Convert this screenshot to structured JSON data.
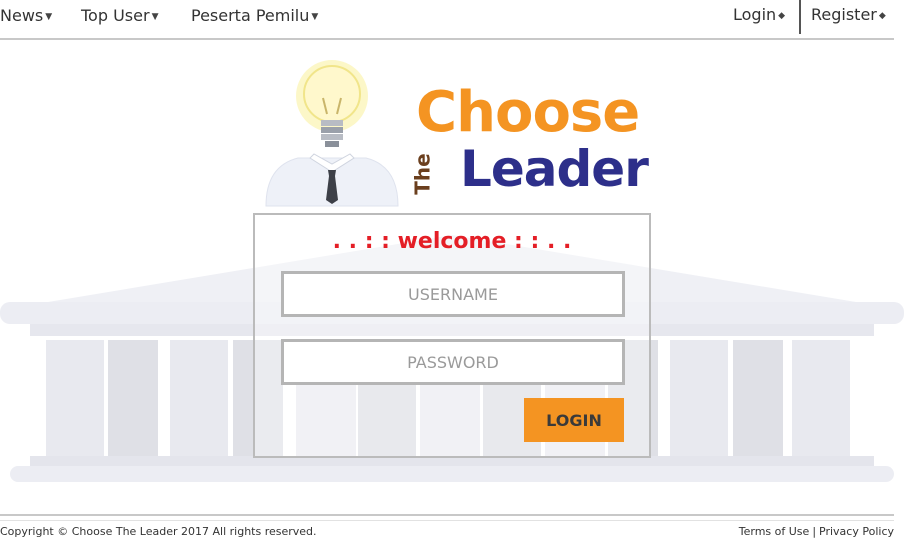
{
  "nav": {
    "left_items": [
      {
        "label": "News",
        "has_dropdown": true
      },
      {
        "label": "Top User",
        "has_dropdown": true
      },
      {
        "label": "Peserta Pemilu",
        "has_dropdown": true
      }
    ],
    "login_label": "Login",
    "register_label": "Register",
    "caret_icon": "triangle-down",
    "side_arrow_icon": "diamond-arrows"
  },
  "brand": {
    "choose": "Choose",
    "the": "The",
    "leader": "Leader",
    "colors": {
      "choose": "#f49422",
      "the": "#6b3f1e",
      "leader": "#2d2f8a"
    },
    "mascot_icon": "lightbulb-head-with-tie"
  },
  "login": {
    "welcome": ". . : : welcome : : . .",
    "username_placeholder": "USERNAME",
    "password_placeholder": "PASSWORD",
    "button_label": "LOGIN",
    "colors": {
      "welcome": "#e41e26",
      "button": "#f49422"
    }
  },
  "footer": {
    "copyright": "Copyright © Choose The Leader 2017 All rights reserved.",
    "terms": "Terms of Use",
    "separator": "|",
    "privacy": "Privacy Policy"
  }
}
